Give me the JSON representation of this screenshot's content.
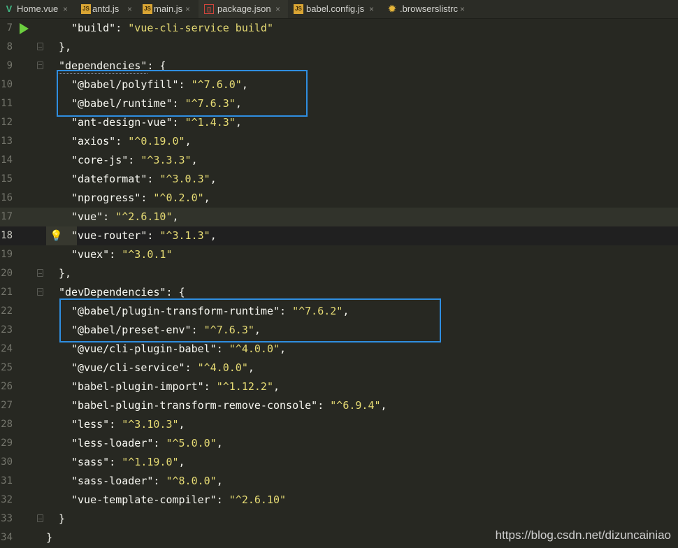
{
  "tabs": [
    {
      "label": "Home.vue",
      "icon": "vue-icon",
      "glyph": "V"
    },
    {
      "label": "antd.js",
      "icon": "js-icon",
      "glyph": "JS"
    },
    {
      "label": "main.js",
      "icon": "js-icon",
      "glyph": "JS"
    },
    {
      "label": "package.json",
      "icon": "json-icon",
      "glyph": "[]",
      "active": true
    },
    {
      "label": "babel.config.js",
      "icon": "js-icon",
      "glyph": "JS"
    },
    {
      "label": ".browserslistrc",
      "icon": "gear-icon",
      "glyph": "✹"
    }
  ],
  "close_glyph": "×",
  "lines": [
    {
      "n": "7",
      "key": "\"build\"",
      "val": "\"vue-cli-service build\"",
      "end": ""
    },
    {
      "n": "8",
      "raw": "},"
    },
    {
      "n": "9",
      "key": "\"dependencies\"",
      "open": "{"
    },
    {
      "n": "10",
      "key": "\"@babel/polyfill\"",
      "val": "\"^7.6.0\"",
      "end": ","
    },
    {
      "n": "11",
      "key": "\"@babel/runtime\"",
      "val": "\"^7.6.3\"",
      "end": ","
    },
    {
      "n": "12",
      "key": "\"ant-design-vue\"",
      "val": "\"^1.4.3\"",
      "end": ","
    },
    {
      "n": "13",
      "key": "\"axios\"",
      "val": "\"^0.19.0\"",
      "end": ","
    },
    {
      "n": "14",
      "key": "\"core-js\"",
      "val": "\"^3.3.3\"",
      "end": ","
    },
    {
      "n": "15",
      "key": "\"dateformat\"",
      "val": "\"^3.0.3\"",
      "end": ","
    },
    {
      "n": "16",
      "key": "\"nprogress\"",
      "val": "\"^0.2.0\"",
      "end": ","
    },
    {
      "n": "17",
      "key": "\"vue\"",
      "val": "\"^2.6.10\"",
      "end": ","
    },
    {
      "n": "18",
      "key": "\"vue-router\"",
      "val": "\"^3.1.3\"",
      "end": ","
    },
    {
      "n": "19",
      "key": "\"vuex\"",
      "val": "\"^3.0.1\"",
      "end": ""
    },
    {
      "n": "20",
      "raw": "},"
    },
    {
      "n": "21",
      "key": "\"devDependencies\"",
      "open": "{"
    },
    {
      "n": "22",
      "key": "\"@babel/plugin-transform-runtime\"",
      "val": "\"^7.6.2\"",
      "end": ","
    },
    {
      "n": "23",
      "key": "\"@babel/preset-env\"",
      "val": "\"^7.6.3\"",
      "end": ","
    },
    {
      "n": "24",
      "key": "\"@vue/cli-plugin-babel\"",
      "val": "\"^4.0.0\"",
      "end": ","
    },
    {
      "n": "25",
      "key": "\"@vue/cli-service\"",
      "val": "\"^4.0.0\"",
      "end": ","
    },
    {
      "n": "26",
      "key": "\"babel-plugin-import\"",
      "val": "\"^1.12.2\"",
      "end": ","
    },
    {
      "n": "27",
      "key": "\"babel-plugin-transform-remove-console\"",
      "val": "\"^6.9.4\"",
      "end": ","
    },
    {
      "n": "28",
      "key": "\"less\"",
      "val": "\"^3.10.3\"",
      "end": ","
    },
    {
      "n": "29",
      "key": "\"less-loader\"",
      "val": "\"^5.0.0\"",
      "end": ","
    },
    {
      "n": "30",
      "key": "\"sass\"",
      "val": "\"^1.19.0\"",
      "end": ","
    },
    {
      "n": "31",
      "key": "\"sass-loader\"",
      "val": "\"^8.0.0\"",
      "end": ","
    },
    {
      "n": "32",
      "key": "\"vue-template-compiler\"",
      "val": "\"^2.6.10\"",
      "end": ""
    },
    {
      "n": "33",
      "raw": "}"
    },
    {
      "n": "34",
      "raw": "}"
    }
  ],
  "bulb_glyph": "💡",
  "watermark": "https://blog.csdn.net/dizuncainiao",
  "colors": {
    "background": "#272822",
    "string": "#e6db74",
    "highlight_box": "#2f8ee0",
    "run_icon": "#6ccf3f"
  }
}
